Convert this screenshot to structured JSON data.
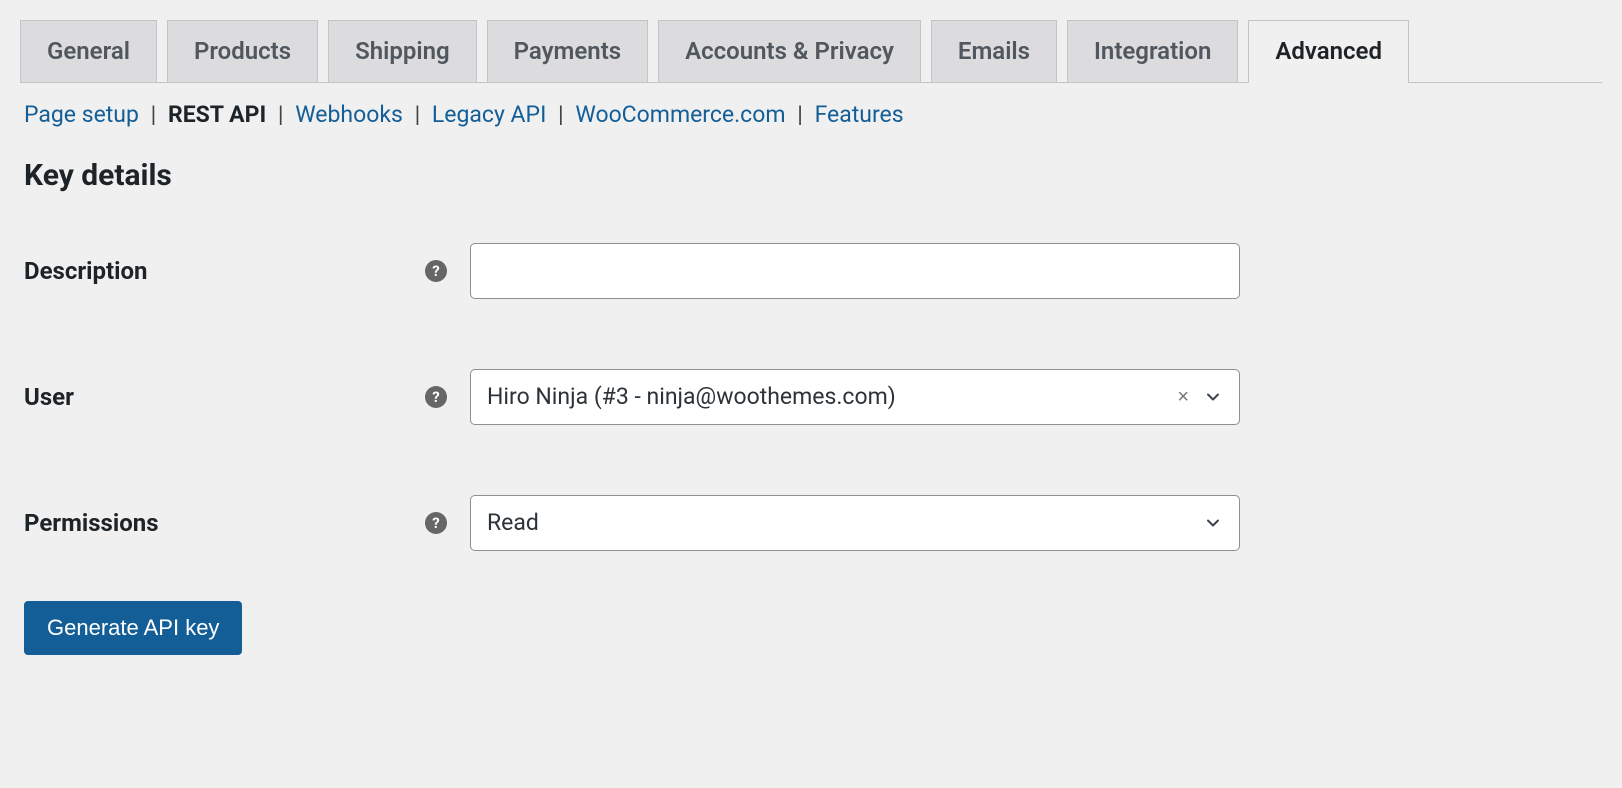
{
  "tabs": {
    "items": [
      {
        "label": "General"
      },
      {
        "label": "Products"
      },
      {
        "label": "Shipping"
      },
      {
        "label": "Payments"
      },
      {
        "label": "Accounts & Privacy"
      },
      {
        "label": "Emails"
      },
      {
        "label": "Integration"
      },
      {
        "label": "Advanced"
      }
    ],
    "active_index": 7
  },
  "sub_nav": {
    "items": [
      {
        "label": "Page setup"
      },
      {
        "label": "REST API"
      },
      {
        "label": "Webhooks"
      },
      {
        "label": "Legacy API"
      },
      {
        "label": "WooCommerce.com"
      },
      {
        "label": "Features"
      }
    ],
    "active_index": 1
  },
  "section_title": "Key details",
  "form": {
    "description": {
      "label": "Description",
      "value": ""
    },
    "user": {
      "label": "User",
      "selected": "Hiro Ninja (#3 - ninja@woothemes.com)"
    },
    "permissions": {
      "label": "Permissions",
      "selected": "Read"
    }
  },
  "actions": {
    "generate_label": "Generate API key"
  },
  "colors": {
    "link": "#135e96",
    "primary": "#135e96",
    "border": "#8c8f94"
  }
}
